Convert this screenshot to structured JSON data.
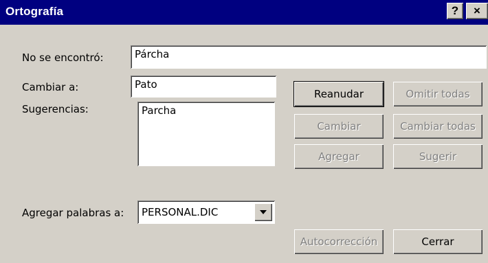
{
  "window": {
    "title": "Ortografía",
    "help_glyph": "?",
    "close_glyph": "×"
  },
  "labels": {
    "not_found": "No se encontró:",
    "change_to": "Cambiar a:",
    "suggestions": "Sugerencias:",
    "add_words_to": "Agregar palabras a:"
  },
  "fields": {
    "not_found_value": "Párcha",
    "change_to_value": "Pato"
  },
  "suggestions": [
    "Parcha"
  ],
  "dictionary": {
    "selected": "PERSONAL.DIC"
  },
  "buttons": {
    "resume": "Reanudar",
    "ignore_all": "Omitir todas",
    "change": "Cambiar",
    "change_all": "Cambiar todas",
    "add": "Agregar",
    "suggest": "Sugerir",
    "autocorrect": "Autocorrección",
    "close": "Cerrar"
  },
  "icons": {
    "help": "help-icon",
    "close": "close-icon",
    "dropdown": "chevron-down-icon"
  }
}
